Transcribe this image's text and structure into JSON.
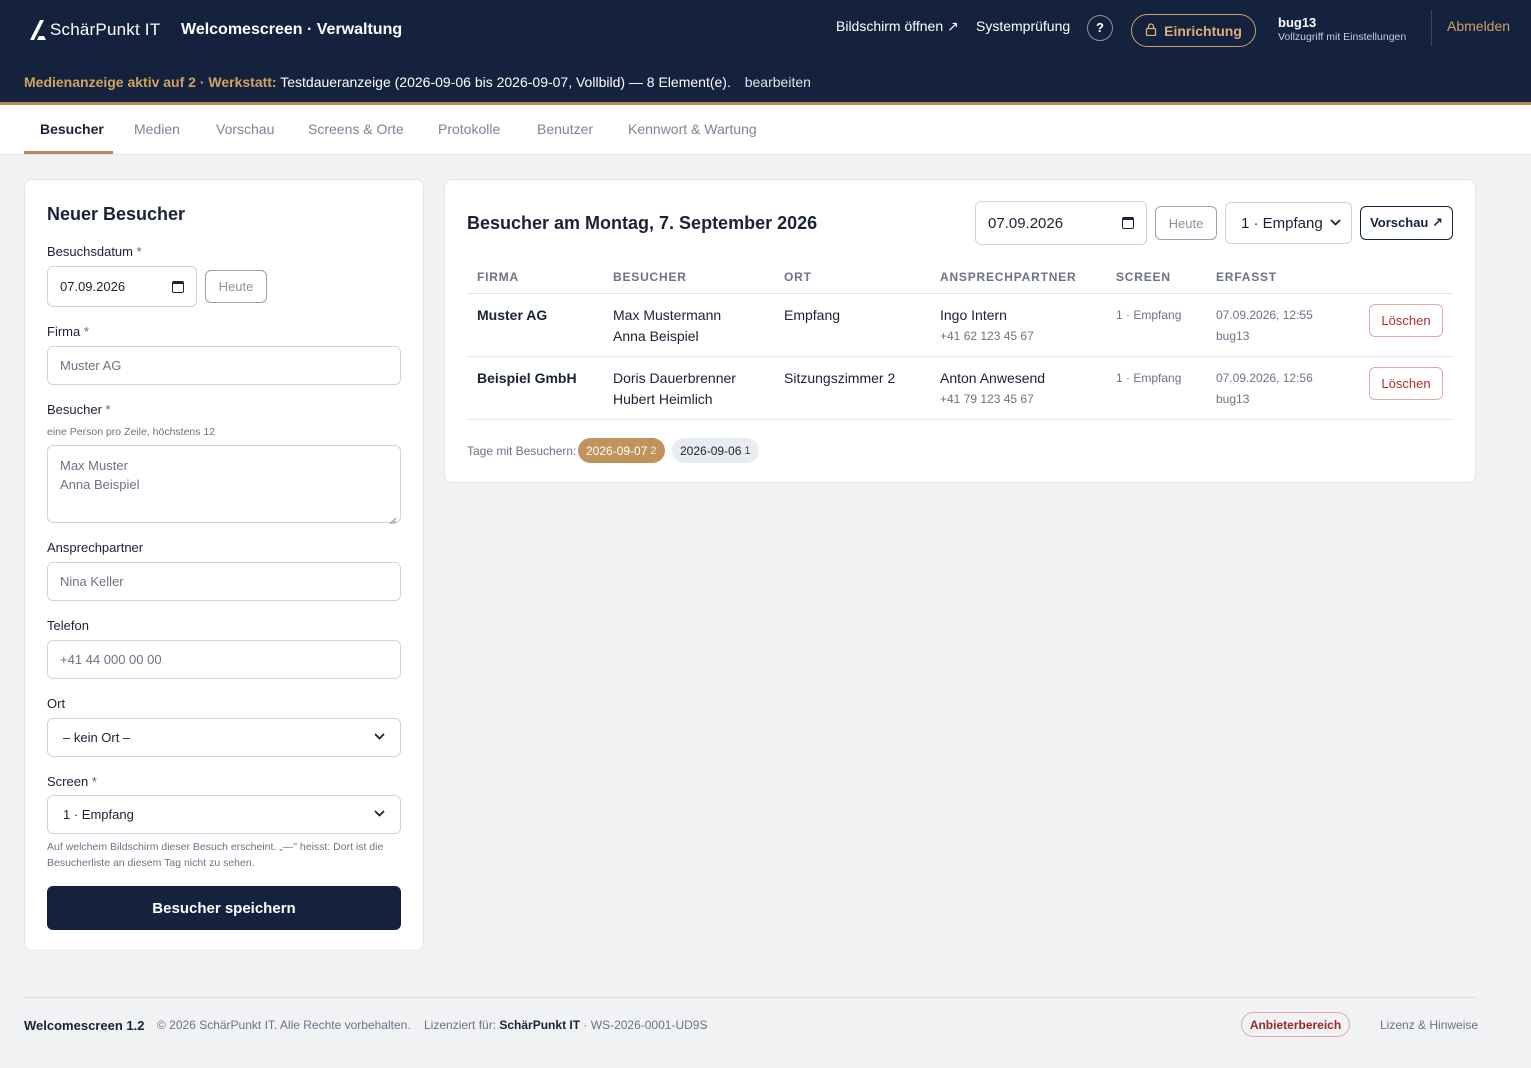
{
  "header": {
    "logo_text": "SchärPunkt IT",
    "app_title": "Welcomescreen · Verwaltung",
    "open_screen": "Bildschirm öffnen ↗",
    "system_check": "Systemprüfung",
    "help": "?",
    "setup": "Einrichtung",
    "user_name": "bug13",
    "user_role": "Vollzugriff mit Einstellungen",
    "logout": "Abmelden",
    "media_highlight": "Medienanzeige aktiv auf 2 · Werkstatt:",
    "media_text": "Testdaueranzeige (2026-09-06 bis 2026-09-07, Vollbild) — 8 Element(e).",
    "media_edit": "bearbeiten"
  },
  "tabs": [
    "Besucher",
    "Medien",
    "Vorschau",
    "Screens & Orte",
    "Protokolle",
    "Benutzer",
    "Kennwort & Wartung"
  ],
  "form": {
    "title": "Neuer Besucher",
    "date_label": "Besuchsdatum",
    "date_value": "07.09.2026",
    "today": "Heute",
    "company_label": "Firma",
    "company_placeholder": "Muster AG",
    "visitors_label": "Besucher",
    "visitors_hint": "eine Person pro Zeile, höchstens 12",
    "visitors_placeholder_1": "Max Muster",
    "visitors_placeholder_2": "Anna Beispiel",
    "contact_label": "Ansprechpartner",
    "contact_placeholder": "Nina Keller",
    "phone_label": "Telefon",
    "phone_placeholder": "+41 44 000 00 00",
    "location_label": "Ort",
    "location_value": "– kein Ort –",
    "screen_label": "Screen",
    "screen_value": "1 · Empfang",
    "screen_hint_1": "Auf welchem Bildschirm dieser Besuch erscheint. „—\" heisst: Dort ist die",
    "screen_hint_2": "Besucherliste an diesem Tag nicht zu sehen.",
    "required_mark": "*",
    "save": "Besucher speichern"
  },
  "list": {
    "title": "Besucher am Montag, 7. September 2026",
    "date_value": "07.09.2026",
    "today": "Heute",
    "screen_value": "1 · Empfang",
    "preview": "Vorschau ↗",
    "columns": [
      "FIRMA",
      "BESUCHER",
      "ORT",
      "ANSPRECHPARTNER",
      "SCREEN",
      "ERFASST"
    ],
    "rows": [
      {
        "company": "Muster AG",
        "visitor_1": "Max Mustermann",
        "visitor_2": "Anna Beispiel",
        "location": "Empfang",
        "contact": "Ingo Intern",
        "phone": "+41 62 123 45 67",
        "screen": "1 · Empfang",
        "created": "07.09.2026, 12:55",
        "created_by": "bug13",
        "delete": "Löschen"
      },
      {
        "company": "Beispiel GmbH",
        "visitor_1": "Doris Dauerbrenner",
        "visitor_2": "Hubert Heimlich",
        "location": "Sitzungszimmer 2",
        "contact": "Anton Anwesend",
        "phone": "+41 79 123 45 67",
        "screen": "1 · Empfang",
        "created": "07.09.2026, 12:56",
        "created_by": "bug13",
        "delete": "Löschen"
      }
    ],
    "days_label": "Tage mit Besuchern:",
    "days": [
      {
        "date": "2026-09-07",
        "count": "2"
      },
      {
        "date": "2026-09-06",
        "count": "1"
      }
    ]
  },
  "footer": {
    "brand": "Welcomescreen 1.2",
    "copyright": "© 2026 SchärPunkt IT. Alle Rechte vorbehalten.",
    "licensed_for": "Lizenziert für:",
    "licensee": "SchärPunkt IT",
    "license_id": "· WS-2026-0001-UD9S",
    "provider": "Anbieterbereich",
    "license_notes": "Lizenz & Hinweise"
  },
  "colors": {
    "navy": "#14223d",
    "accent": "#b58a57",
    "danger": "#b62a2a"
  }
}
